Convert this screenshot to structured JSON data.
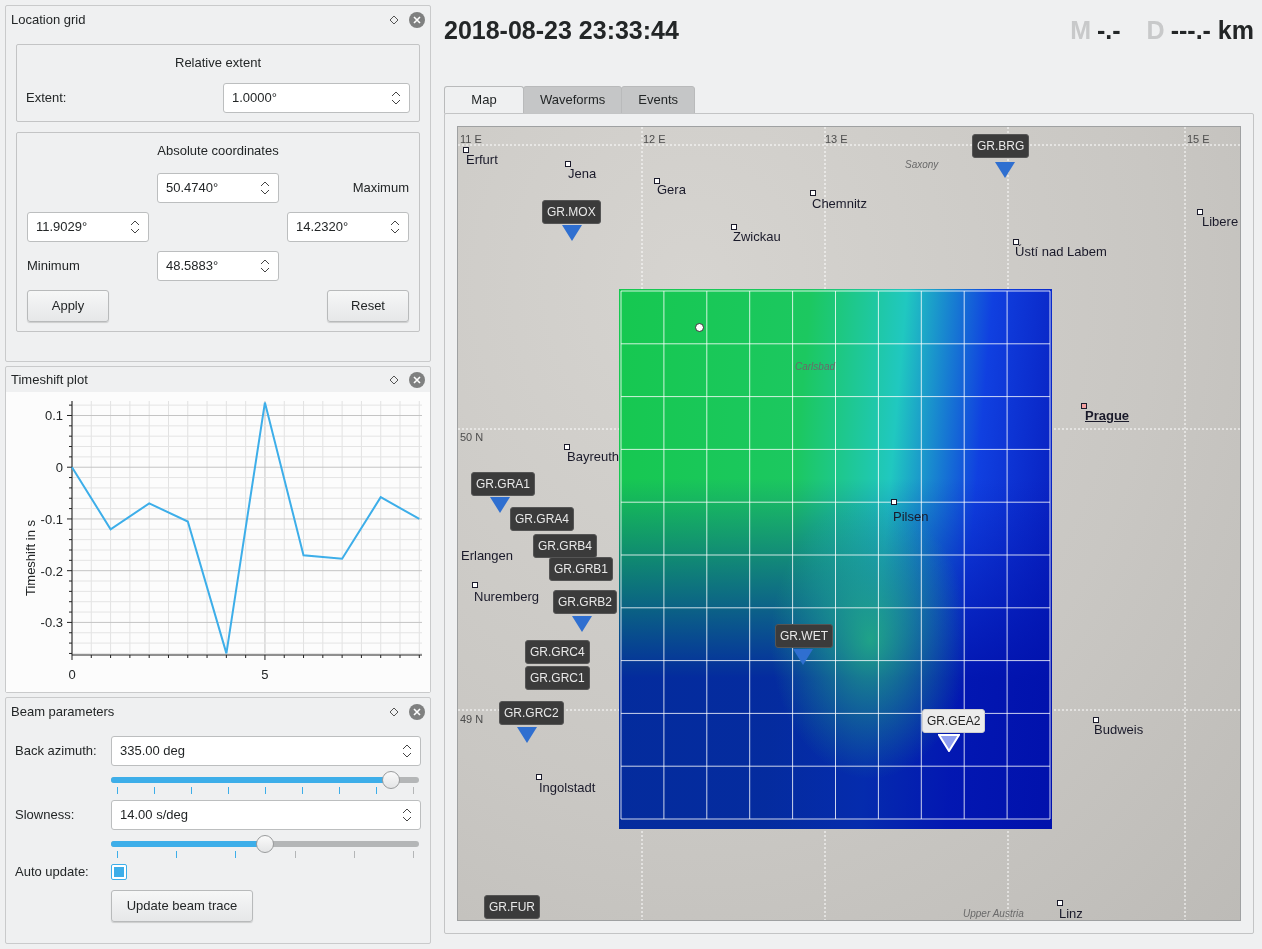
{
  "location_grid": {
    "title": "Location grid",
    "relative_extent": {
      "title": "Relative extent",
      "extent_label": "Extent:",
      "extent_value": "1.0000°"
    },
    "absolute_coordinates": {
      "title": "Absolute coordinates",
      "maximum_label": "Maximum",
      "minimum_label": "Minimum",
      "north": "50.4740°",
      "west": "11.9029°",
      "east": "14.2320°",
      "south": "48.5883°"
    },
    "buttons": [
      "Apply",
      "Reset"
    ]
  },
  "timeshift_plot": {
    "title": "Timeshift plot",
    "chart_data": {
      "type": "line",
      "ylabel": "Timeshift in s",
      "x": [
        0,
        1,
        2,
        3,
        4,
        5,
        6,
        7,
        8,
        9
      ],
      "grid": true,
      "series": [
        {
          "color": "#3daee9",
          "values": [
            0.0,
            -0.12,
            -0.07,
            -0.105,
            -0.36,
            0.125,
            -0.17,
            -0.177,
            -0.058,
            -0.1
          ]
        }
      ],
      "xlim": [
        0,
        9.07
      ],
      "ylim": [
        -0.363,
        0.128
      ],
      "xticks": [
        0,
        5
      ],
      "yticks": [
        -0.3,
        -0.2,
        -0.1,
        0,
        0.1
      ]
    }
  },
  "beam_parameters": {
    "title": "Beam parameters",
    "back_azimuth": {
      "label": "Back azimuth:",
      "value": "335.00 deg",
      "level": 0.91
    },
    "slowness": {
      "label": "Slowness:",
      "value": "14.00 s/deg",
      "level": 0.5
    },
    "auto_update": {
      "label": "Auto update:",
      "checked": true
    },
    "button": "Update beam trace"
  },
  "header": {
    "datetime": "2018-08-23 23:33:44",
    "magnitude_label": "M",
    "magnitude_value": "-.-",
    "distance_label": "D",
    "distance_value": "---.- km"
  },
  "tabs": [
    {
      "label": "Map",
      "selected": true
    },
    {
      "label": "Waveforms",
      "selected": false
    },
    {
      "label": "Events",
      "selected": false
    }
  ],
  "map": {
    "grid_labels": [
      "11 E",
      "12 E",
      "13 E",
      "15 E",
      "50 N",
      "49 N"
    ],
    "places": [
      {
        "name": "Erfurt",
        "kind": "city"
      },
      {
        "name": "Jena",
        "kind": "city"
      },
      {
        "name": "Gera",
        "kind": "city"
      },
      {
        "name": "Chemnitz",
        "kind": "city"
      },
      {
        "name": "Zwickau",
        "kind": "city"
      },
      {
        "name": "Saxony",
        "kind": "region"
      },
      {
        "name": "Ústí nad Labem",
        "kind": "city"
      },
      {
        "name": "Libere",
        "kind": "city"
      },
      {
        "name": "Carlsbad",
        "kind": "region"
      },
      {
        "name": "Prague",
        "kind": "capital"
      },
      {
        "name": "Bayreuth",
        "kind": "city"
      },
      {
        "name": "Pilsen",
        "kind": "city"
      },
      {
        "name": "Erlangen",
        "kind": "city"
      },
      {
        "name": "Nuremberg",
        "kind": "city"
      },
      {
        "name": "Budweis",
        "kind": "city"
      },
      {
        "name": "Ingolstadt",
        "kind": "city"
      },
      {
        "name": "Linz",
        "kind": "city"
      },
      {
        "name": "Upper Austria",
        "kind": "region"
      }
    ],
    "stations": [
      {
        "code": "GR.BRG",
        "selected": false
      },
      {
        "code": "GR.MOX",
        "selected": false
      },
      {
        "code": "GR.GRA1",
        "selected": false
      },
      {
        "code": "GR.GRA4",
        "selected": false
      },
      {
        "code": "GR.GRB4",
        "selected": false
      },
      {
        "code": "GR.GRB1",
        "selected": false
      },
      {
        "code": "GR.GRB2",
        "selected": false
      },
      {
        "code": "GR.GRC4",
        "selected": false
      },
      {
        "code": "GR.GRC1",
        "selected": false
      },
      {
        "code": "GR.GRC2",
        "selected": false
      },
      {
        "code": "GR.WET",
        "selected": false
      },
      {
        "code": "GR.GEA2",
        "selected": true
      },
      {
        "code": "GR.FUR",
        "selected": false
      }
    ]
  }
}
